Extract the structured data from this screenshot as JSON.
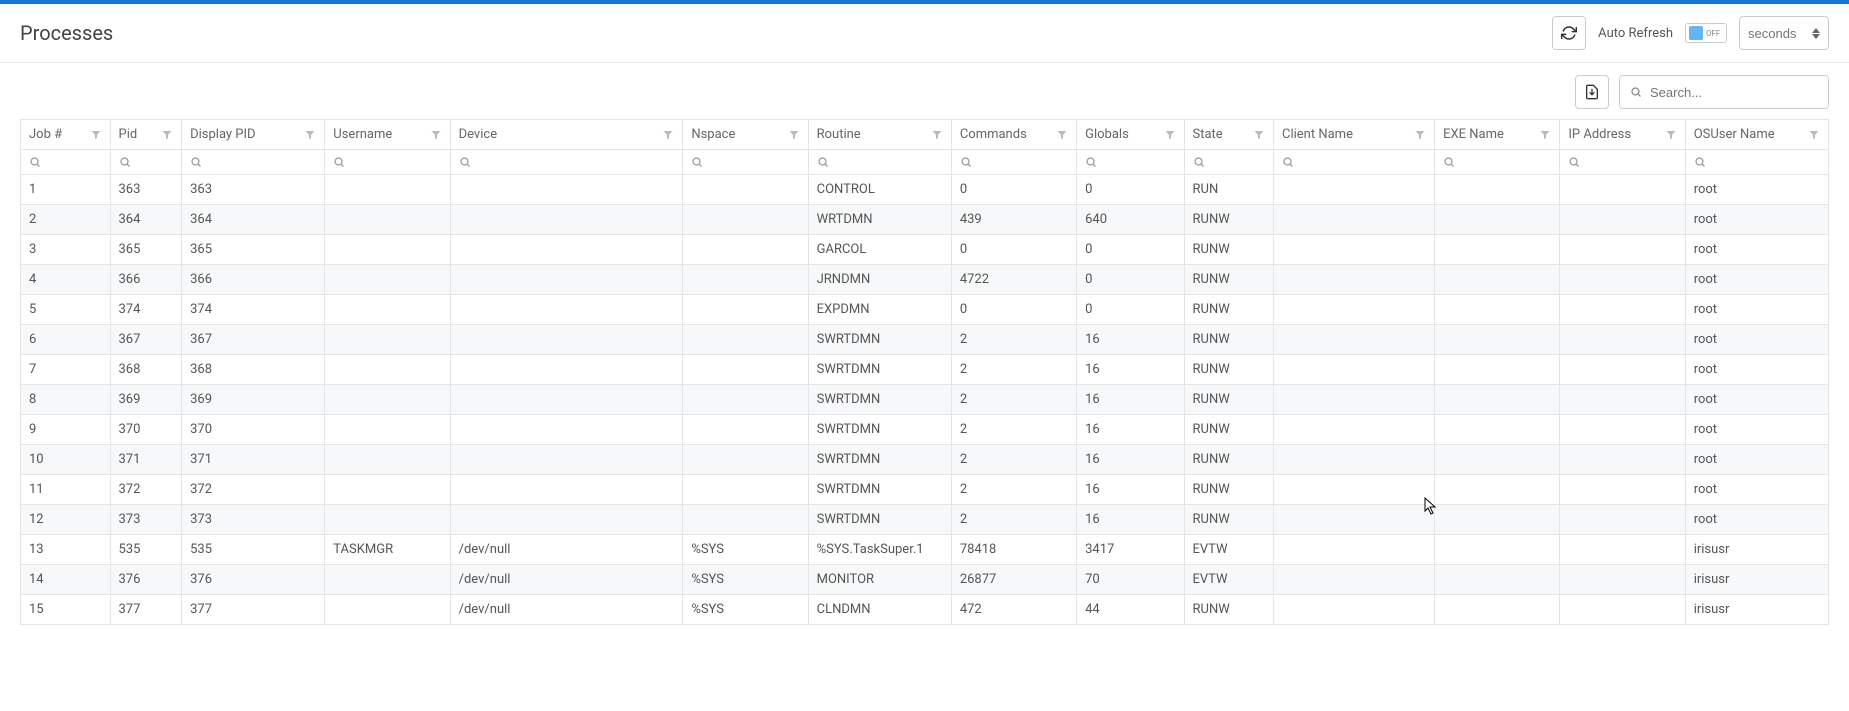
{
  "header": {
    "title": "Processes",
    "autoRefreshLabel": "Auto Refresh",
    "toggleState": "OFF",
    "secondsPlaceholder": "seconds"
  },
  "toolbar": {
    "searchPlaceholder": "Search..."
  },
  "columns": [
    {
      "label": "Job #",
      "width": "5%"
    },
    {
      "label": "Pid",
      "width": "4%"
    },
    {
      "label": "Display PID",
      "width": "8%"
    },
    {
      "label": "Username",
      "width": "7%"
    },
    {
      "label": "Device",
      "width": "13%"
    },
    {
      "label": "Nspace",
      "width": "7%"
    },
    {
      "label": "Routine",
      "width": "8%"
    },
    {
      "label": "Commands",
      "width": "7%"
    },
    {
      "label": "Globals",
      "width": "6%"
    },
    {
      "label": "State",
      "width": "5%"
    },
    {
      "label": "Client Name",
      "width": "9%"
    },
    {
      "label": "EXE Name",
      "width": "7%"
    },
    {
      "label": "IP Address",
      "width": "7%"
    },
    {
      "label": "OSUser Name",
      "width": "8%"
    }
  ],
  "rows": [
    {
      "job": "1",
      "pid": "363",
      "dpid": "363",
      "user": "",
      "device": "",
      "ns": "",
      "routine": "CONTROL",
      "cmds": "0",
      "globals": "0",
      "state": "RUN",
      "client": "",
      "exe": "",
      "ip": "",
      "osuser": "root"
    },
    {
      "job": "2",
      "pid": "364",
      "dpid": "364",
      "user": "",
      "device": "",
      "ns": "",
      "routine": "WRTDMN",
      "cmds": "439",
      "globals": "640",
      "state": "RUNW",
      "client": "",
      "exe": "",
      "ip": "",
      "osuser": "root"
    },
    {
      "job": "3",
      "pid": "365",
      "dpid": "365",
      "user": "",
      "device": "",
      "ns": "",
      "routine": "GARCOL",
      "cmds": "0",
      "globals": "0",
      "state": "RUNW",
      "client": "",
      "exe": "",
      "ip": "",
      "osuser": "root"
    },
    {
      "job": "4",
      "pid": "366",
      "dpid": "366",
      "user": "",
      "device": "",
      "ns": "",
      "routine": "JRNDMN",
      "cmds": "4722",
      "globals": "0",
      "state": "RUNW",
      "client": "",
      "exe": "",
      "ip": "",
      "osuser": "root"
    },
    {
      "job": "5",
      "pid": "374",
      "dpid": "374",
      "user": "",
      "device": "",
      "ns": "",
      "routine": "EXPDMN",
      "cmds": "0",
      "globals": "0",
      "state": "RUNW",
      "client": "",
      "exe": "",
      "ip": "",
      "osuser": "root"
    },
    {
      "job": "6",
      "pid": "367",
      "dpid": "367",
      "user": "",
      "device": "",
      "ns": "",
      "routine": "SWRTDMN",
      "cmds": "2",
      "globals": "16",
      "state": "RUNW",
      "client": "",
      "exe": "",
      "ip": "",
      "osuser": "root"
    },
    {
      "job": "7",
      "pid": "368",
      "dpid": "368",
      "user": "",
      "device": "",
      "ns": "",
      "routine": "SWRTDMN",
      "cmds": "2",
      "globals": "16",
      "state": "RUNW",
      "client": "",
      "exe": "",
      "ip": "",
      "osuser": "root"
    },
    {
      "job": "8",
      "pid": "369",
      "dpid": "369",
      "user": "",
      "device": "",
      "ns": "",
      "routine": "SWRTDMN",
      "cmds": "2",
      "globals": "16",
      "state": "RUNW",
      "client": "",
      "exe": "",
      "ip": "",
      "osuser": "root"
    },
    {
      "job": "9",
      "pid": "370",
      "dpid": "370",
      "user": "",
      "device": "",
      "ns": "",
      "routine": "SWRTDMN",
      "cmds": "2",
      "globals": "16",
      "state": "RUNW",
      "client": "",
      "exe": "",
      "ip": "",
      "osuser": "root"
    },
    {
      "job": "10",
      "pid": "371",
      "dpid": "371",
      "user": "",
      "device": "",
      "ns": "",
      "routine": "SWRTDMN",
      "cmds": "2",
      "globals": "16",
      "state": "RUNW",
      "client": "",
      "exe": "",
      "ip": "",
      "osuser": "root"
    },
    {
      "job": "11",
      "pid": "372",
      "dpid": "372",
      "user": "",
      "device": "",
      "ns": "",
      "routine": "SWRTDMN",
      "cmds": "2",
      "globals": "16",
      "state": "RUNW",
      "client": "",
      "exe": "",
      "ip": "",
      "osuser": "root"
    },
    {
      "job": "12",
      "pid": "373",
      "dpid": "373",
      "user": "",
      "device": "",
      "ns": "",
      "routine": "SWRTDMN",
      "cmds": "2",
      "globals": "16",
      "state": "RUNW",
      "client": "",
      "exe": "",
      "ip": "",
      "osuser": "root"
    },
    {
      "job": "13",
      "pid": "535",
      "dpid": "535",
      "user": "TASKMGR",
      "device": "/dev/null",
      "ns": "%SYS",
      "routine": "%SYS.TaskSuper.1",
      "cmds": "78418",
      "globals": "3417",
      "state": "EVTW",
      "client": "",
      "exe": "",
      "ip": "",
      "osuser": "irisusr"
    },
    {
      "job": "14",
      "pid": "376",
      "dpid": "376",
      "user": "",
      "device": "/dev/null",
      "ns": "%SYS",
      "routine": "MONITOR",
      "cmds": "26877",
      "globals": "70",
      "state": "EVTW",
      "client": "",
      "exe": "",
      "ip": "",
      "osuser": "irisusr"
    },
    {
      "job": "15",
      "pid": "377",
      "dpid": "377",
      "user": "",
      "device": "/dev/null",
      "ns": "%SYS",
      "routine": "CLNDMN",
      "cmds": "472",
      "globals": "44",
      "state": "RUNW",
      "client": "",
      "exe": "",
      "ip": "",
      "osuser": "irisusr"
    }
  ]
}
